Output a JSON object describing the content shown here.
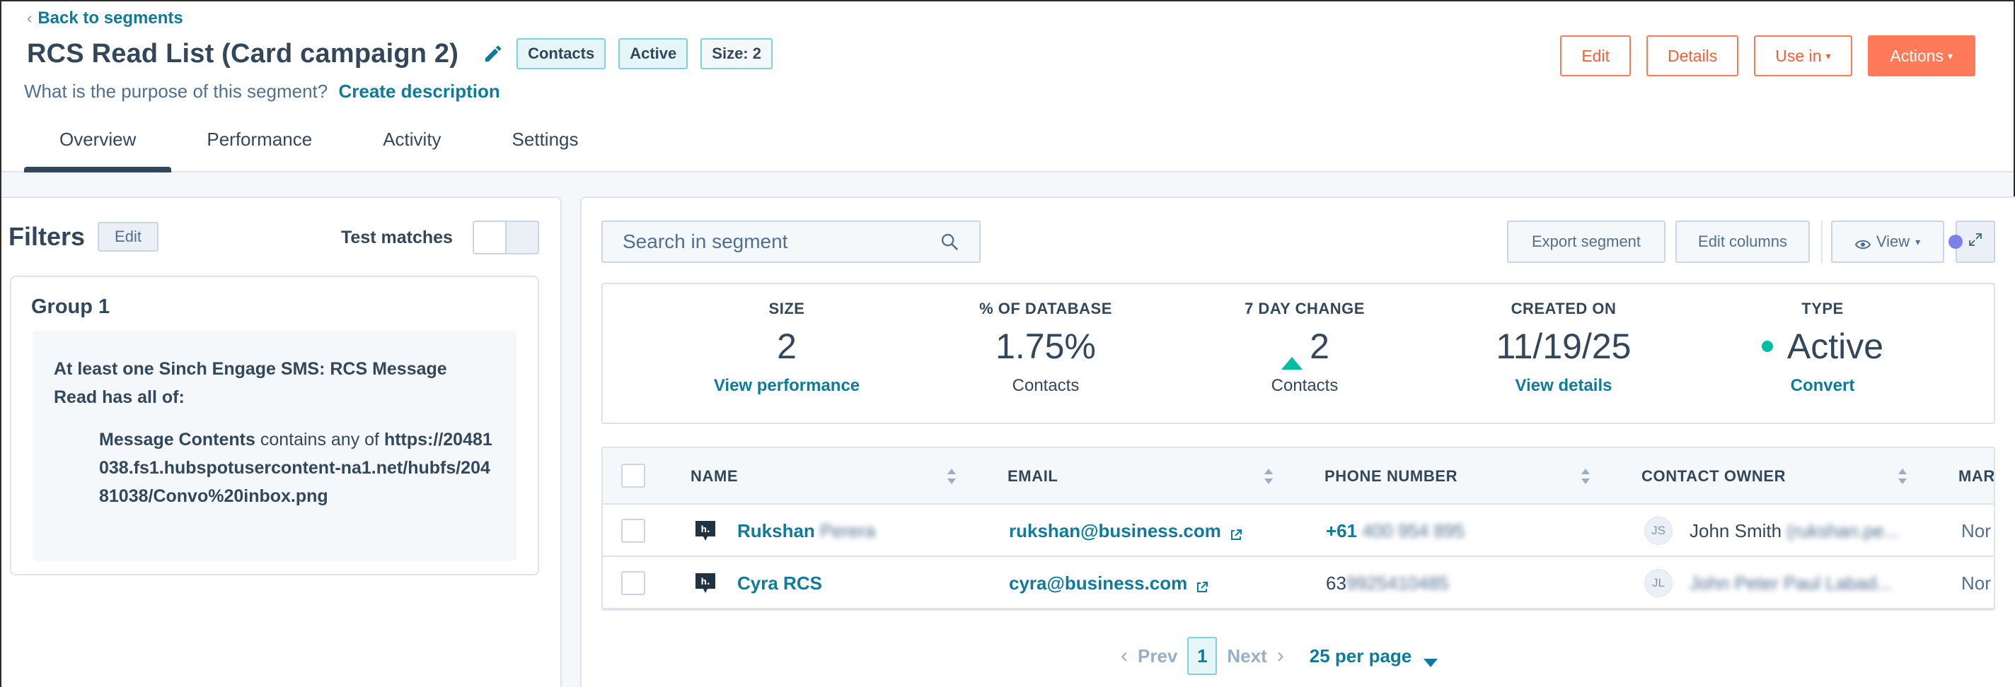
{
  "header": {
    "back_label": "Back to segments",
    "title": "RCS Read List (Card campaign 2)",
    "tags": [
      "Contacts",
      "Active",
      "Size: 2"
    ],
    "purpose_text": "What is the purpose of this segment?",
    "purpose_link": "Create description",
    "actions": {
      "edit": "Edit",
      "details": "Details",
      "use_in": "Use in",
      "actions": "Actions"
    },
    "tabs": [
      "Overview",
      "Performance",
      "Activity",
      "Settings"
    ],
    "active_tab": "Overview"
  },
  "filters": {
    "title": "Filters",
    "edit_label": "Edit",
    "test_matches_label": "Test matches",
    "group": {
      "title": "Group 1",
      "rule": "At least one Sinch Engage SMS: RCS Message Read has all of:",
      "condition_property": "Message Contents",
      "condition_operator": " contains any of ",
      "condition_value": "https://20481038.fs1.hubspotusercontent-na1.net/hubfs/20481038/Convo%20inbox.png"
    }
  },
  "toolbar": {
    "search_placeholder": "Search in segment",
    "export_label": "Export segment",
    "edit_columns_label": "Edit columns",
    "view_label": "View"
  },
  "stats": [
    {
      "label": "SIZE",
      "value": "2",
      "sub": "View performance",
      "sub_is_link": true
    },
    {
      "label": "% OF DATABASE",
      "value": "1.75%",
      "sub": "Contacts",
      "sub_is_link": false
    },
    {
      "label": "7 DAY CHANGE",
      "value": "2",
      "sub": "Contacts",
      "sub_is_link": false
    },
    {
      "label": "CREATED ON",
      "value": "11/19/25",
      "sub": "View details",
      "sub_is_link": true
    },
    {
      "label": "TYPE",
      "value": "Active",
      "sub": "Convert",
      "sub_is_link": true
    }
  ],
  "table": {
    "columns": [
      "NAME",
      "EMAIL",
      "PHONE NUMBER",
      "CONTACT OWNER",
      "MAR"
    ],
    "rows": [
      {
        "name": "Rukshan",
        "name_blurred": "Perera",
        "email": "rukshan@business.com",
        "phone": "+61",
        "phone_blurred": "400 954 895",
        "owner_initials": "JS",
        "owner": "John Smith",
        "owner_blurred": "(rukshan.pe...",
        "marketing": "Nor"
      },
      {
        "name": "Cyra RCS",
        "name_blurred": "",
        "email": "cyra@business.com",
        "phone": "63",
        "phone_blurred": "9925410485",
        "owner_initials": "JL",
        "owner": "",
        "owner_blurred": "John Peter Paul Labad...",
        "marketing": "Nor"
      }
    ]
  },
  "pagination": {
    "prev": "Prev",
    "current": "1",
    "next": "Next",
    "per_page": "25 per page"
  },
  "colors": {
    "accent_orange": "#ff7a59",
    "link_teal": "#0f7b9a",
    "status_green": "#00bda5",
    "text_dark": "#33475b"
  }
}
